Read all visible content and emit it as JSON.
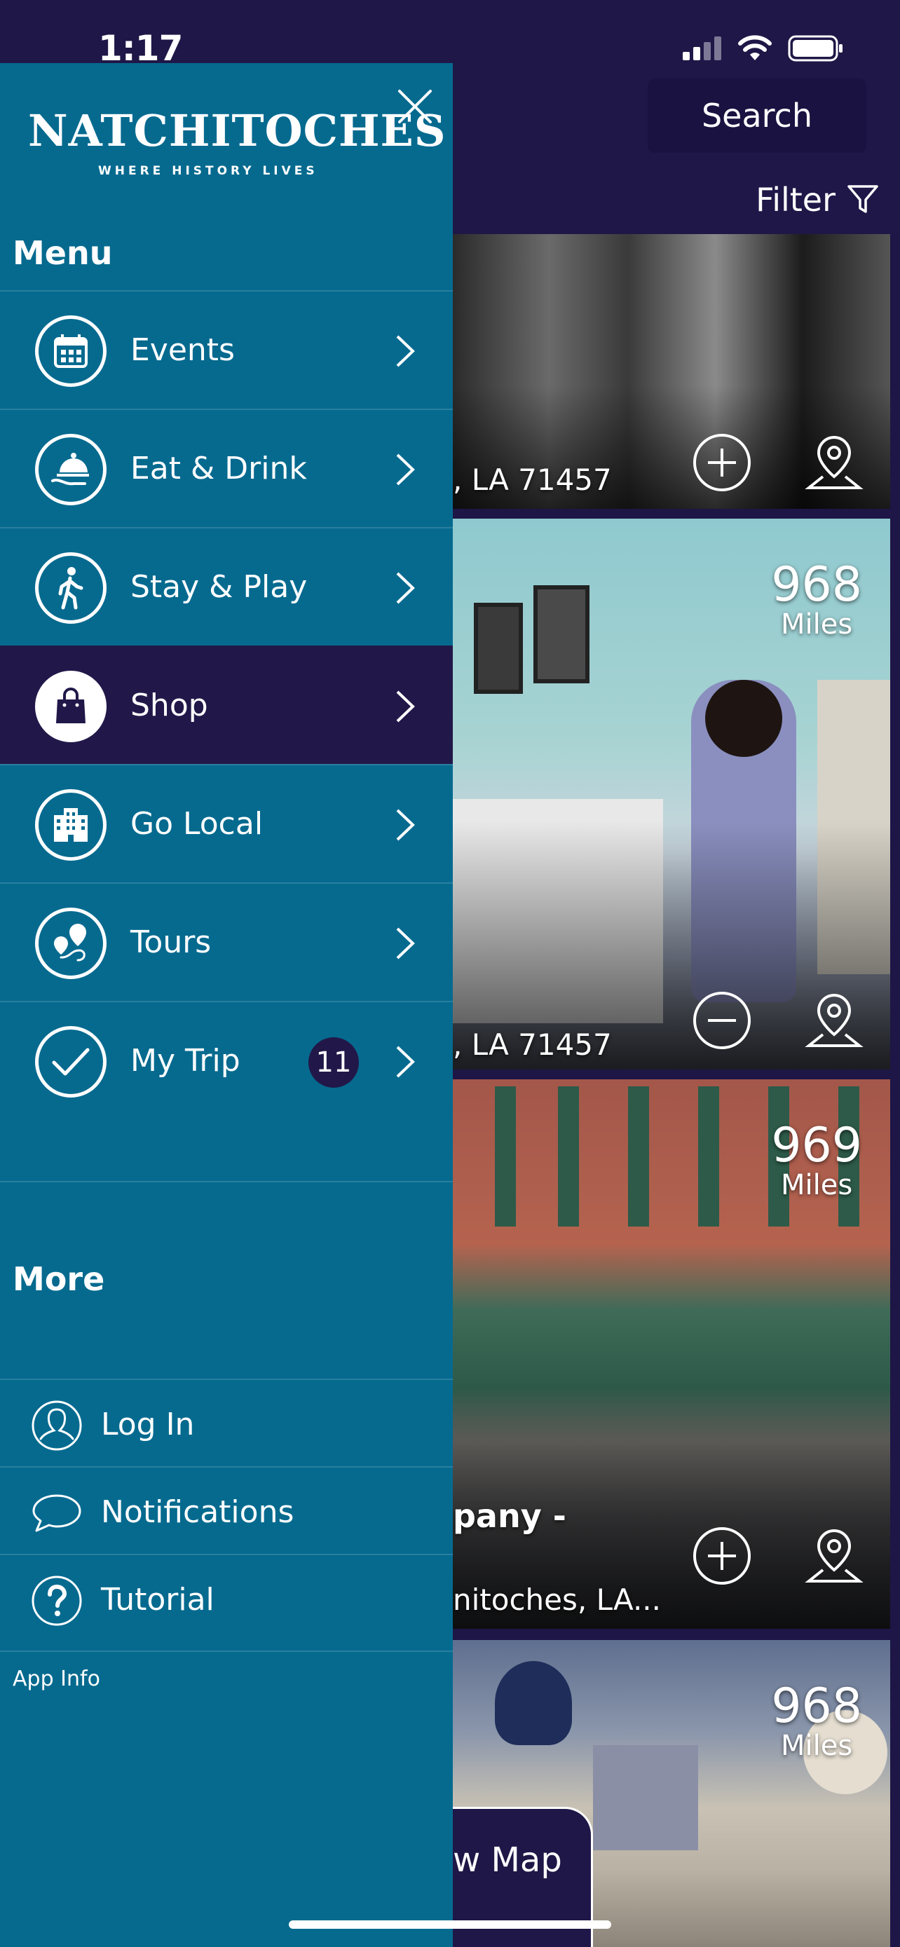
{
  "status_bar": {
    "time": "1:17"
  },
  "header": {
    "search_label": "Search",
    "filter_label": "Filter"
  },
  "listings": [
    {
      "address": ", LA 71457",
      "action": "add"
    },
    {
      "distance": "968",
      "distance_unit": "Miles",
      "address": ", LA 71457",
      "action": "remove"
    },
    {
      "distance": "969",
      "distance_unit": "Miles",
      "title": "pany -",
      "address": "nitoches, LA...",
      "action": "add"
    },
    {
      "distance": "968",
      "distance_unit": "Miles"
    }
  ],
  "map_button_label": "w Map",
  "drawer": {
    "logo_title": "NATCHITOCHES",
    "logo_tagline": "WHERE HISTORY LIVES",
    "menu_heading": "Menu",
    "menu_items": [
      {
        "label": "Events",
        "icon": "calendar-icon"
      },
      {
        "label": "Eat & Drink",
        "icon": "serving-cloche-icon"
      },
      {
        "label": "Stay & Play",
        "icon": "walking-person-icon"
      },
      {
        "label": "Shop",
        "icon": "shopping-bag-icon",
        "active": true
      },
      {
        "label": "Go Local",
        "icon": "building-icon"
      },
      {
        "label": "Tours",
        "icon": "route-pins-icon"
      },
      {
        "label": "My Trip",
        "icon": "checkmark-icon",
        "badge": "11"
      }
    ],
    "more_heading": "More",
    "more_items": [
      {
        "label": "Log In",
        "icon": "user-icon"
      },
      {
        "label": "Notifications",
        "icon": "speech-bubble-icon"
      },
      {
        "label": "Tutorial",
        "icon": "question-icon"
      }
    ],
    "app_info_label": "App Info"
  },
  "colors": {
    "drawer_bg": "#066a8f",
    "active_bg": "#211849",
    "header_bg": "#1f1747",
    "text": "#ffffff"
  }
}
